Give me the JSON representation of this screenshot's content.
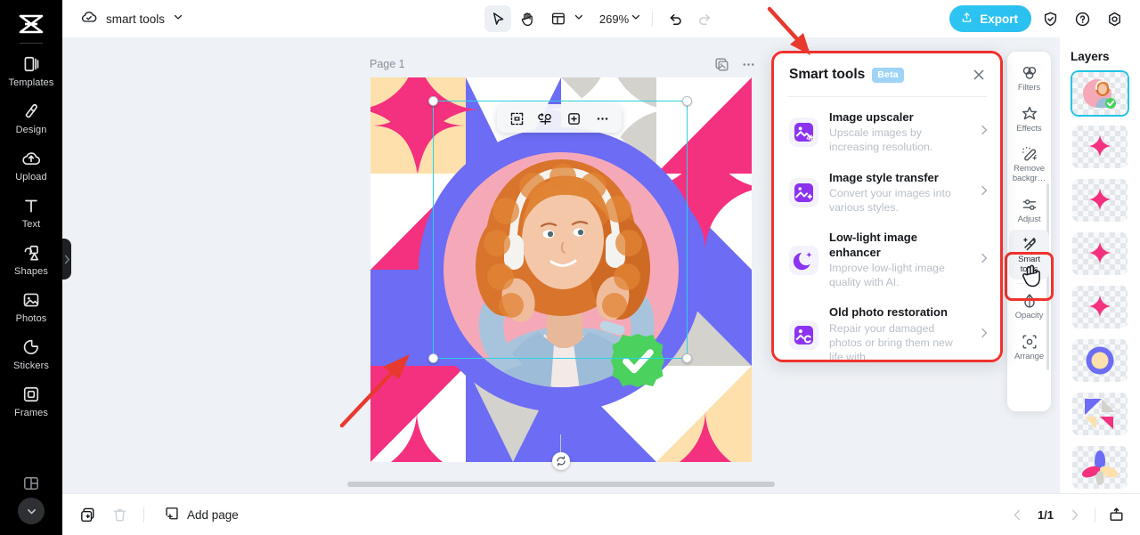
{
  "app": {
    "brand": "capcut-logo",
    "doc_title": "smart tools"
  },
  "topbar": {
    "cloud_icon": "cloud-check-icon",
    "title_caret": "chevron-down-icon",
    "tools": [
      {
        "name": "select-tool",
        "icon": "cursor-arrow-icon",
        "active": true
      },
      {
        "name": "hand-tool",
        "icon": "hand-icon",
        "active": false
      },
      {
        "name": "layout-tool",
        "icon": "layout-grid-icon",
        "active": false
      }
    ],
    "zoom_level": "269%",
    "undo_label": "undo-icon",
    "redo_label": "redo-icon",
    "export_label": "Export",
    "export_icon": "upload-icon",
    "export_color": "#29c3f0",
    "right_icons": [
      {
        "name": "shield-check-icon"
      },
      {
        "name": "help-circle-icon"
      },
      {
        "name": "settings-gear-icon"
      }
    ]
  },
  "sidebar": {
    "items": [
      {
        "label": "Templates",
        "icon": "templates-icon"
      },
      {
        "label": "Design",
        "icon": "design-icon"
      },
      {
        "label": "Upload",
        "icon": "upload-cloud-icon"
      },
      {
        "label": "Text",
        "icon": "text-icon"
      },
      {
        "label": "Shapes",
        "icon": "shapes-icon"
      },
      {
        "label": "Photos",
        "icon": "photos-icon"
      },
      {
        "label": "Stickers",
        "icon": "stickers-icon"
      },
      {
        "label": "Frames",
        "icon": "frames-icon"
      }
    ],
    "collapse_icon": "chevron-down-icon",
    "more_icon": "more-panels-icon"
  },
  "canvas": {
    "page_label": "Page 1",
    "page_tools": [
      {
        "name": "duplicate-page-icon"
      },
      {
        "name": "page-more-options-icon"
      }
    ],
    "floating_toolbar": [
      {
        "name": "crop-icon"
      },
      {
        "name": "flip-icon"
      },
      {
        "name": "replace-image-icon"
      },
      {
        "name": "more-options-icon"
      }
    ],
    "rotate_handle": "rotate-icon",
    "artwork_colors": {
      "blue": "#6c6cf5",
      "pink": "#f4317f",
      "peach": "#fde0ac",
      "grey": "#d4d2cd",
      "white": "#ffffff",
      "circle_pink": "#f5a9b8",
      "badge_green": "#4ad15e"
    }
  },
  "smart_tools_panel": {
    "title": "Smart tools",
    "badge": "Beta",
    "close_icon": "close-icon",
    "highlight_color": "#f0322e",
    "items": [
      {
        "name": "Image upscaler",
        "desc": "Upscale images by increasing resolution.",
        "icon": "image-upscaler-4k-icon",
        "chevron": "chevron-right-icon"
      },
      {
        "name": "Image style transfer",
        "desc": "Convert your images into various styles.",
        "icon": "image-style-transfer-icon",
        "chevron": "chevron-right-icon"
      },
      {
        "name": "Low-light image enhancer",
        "desc": "Improve low-light image quality with AI.",
        "icon": "moon-stars-icon",
        "chevron": "chevron-right-icon"
      },
      {
        "name": "Old photo restoration",
        "desc": "Repair your damaged photos or bring them new life with…",
        "icon": "old-photo-restoration-icon",
        "chevron": "chevron-right-icon"
      }
    ]
  },
  "tools_strip": {
    "items": [
      {
        "label": "Filters",
        "icon": "filters-icon",
        "selected": false
      },
      {
        "label": "Effects",
        "icon": "effects-icon",
        "selected": false
      },
      {
        "label": "Remove backgr…",
        "icon": "remove-background-icon",
        "selected": false
      },
      {
        "label": "Adjust",
        "icon": "adjust-sliders-icon",
        "selected": false
      },
      {
        "label": "Smart tools",
        "icon": "smart-tools-wand-icon",
        "selected": true
      },
      {
        "label": "Opacity",
        "icon": "opacity-drop-icon",
        "selected": false
      },
      {
        "label": "Arrange",
        "icon": "arrange-icon",
        "selected": false
      }
    ]
  },
  "layers": {
    "title": "Layers",
    "thumbs": [
      {
        "name": "layer-portrait",
        "type": "portrait",
        "active": true
      },
      {
        "name": "layer-star-1",
        "type": "star",
        "active": false
      },
      {
        "name": "layer-star-2",
        "type": "star",
        "active": false
      },
      {
        "name": "layer-star-3",
        "type": "star",
        "active": false
      },
      {
        "name": "layer-star-4",
        "type": "star",
        "active": false
      },
      {
        "name": "layer-circle",
        "type": "circle",
        "active": false
      },
      {
        "name": "layer-triangles",
        "type": "triangles",
        "active": false
      },
      {
        "name": "layer-petals",
        "type": "petals",
        "active": false
      }
    ]
  },
  "bottombar": {
    "duplicate_icon": "duplicate-icon",
    "delete_icon": "trash-icon",
    "add_page_label": "Add page",
    "add_page_icon": "add-page-icon",
    "prev_icon": "chevron-left-icon",
    "next_icon": "chevron-right-icon",
    "page_indicator": "1/1",
    "present_icon": "present-icon"
  }
}
